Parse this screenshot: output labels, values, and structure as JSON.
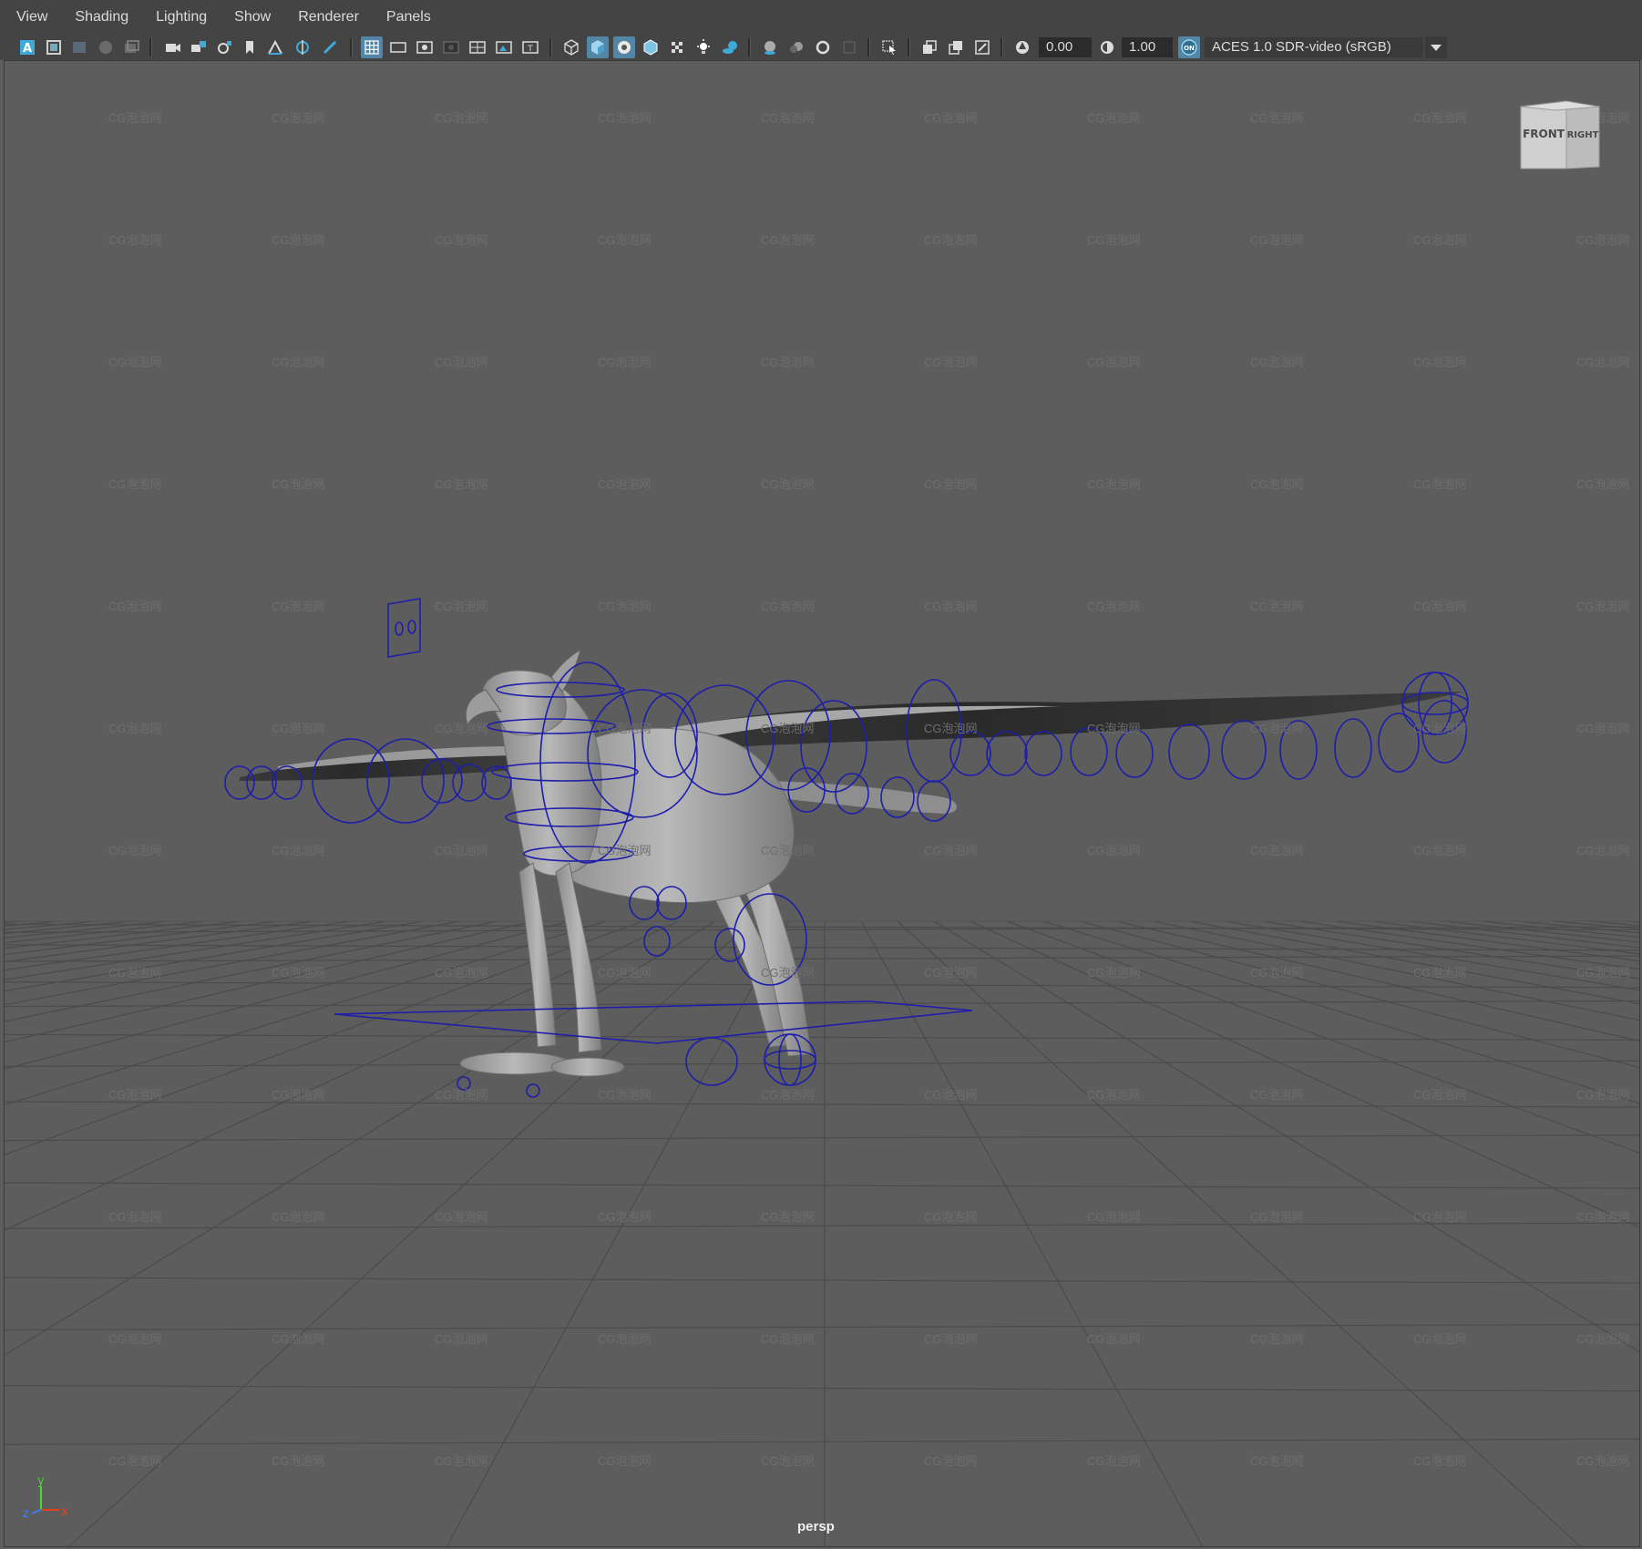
{
  "menu": [
    "View",
    "Shading",
    "Lighting",
    "Show",
    "Renderer",
    "Panels"
  ],
  "toolbar": {
    "exposure_value": "0.00",
    "gamma_value": "1.00",
    "color_mgmt_badge": "ON",
    "color_space": "ACES 1.0 SDR-video (sRGB)"
  },
  "viewport": {
    "camera_label": "persp",
    "watermark_text": "CG泡泡网",
    "viewcube": {
      "front_label": "FRONT",
      "right_label": "RIGHT"
    },
    "axis": {
      "y_label": "y",
      "z_label": "z",
      "x_label": "x"
    }
  },
  "colors": {
    "ui_bg": "#444444",
    "viewport_bg": "#5d5d5d",
    "active_icon": "#5285a6",
    "rig_controls": "#1e1eaa",
    "grid": "#4a4a4a"
  }
}
